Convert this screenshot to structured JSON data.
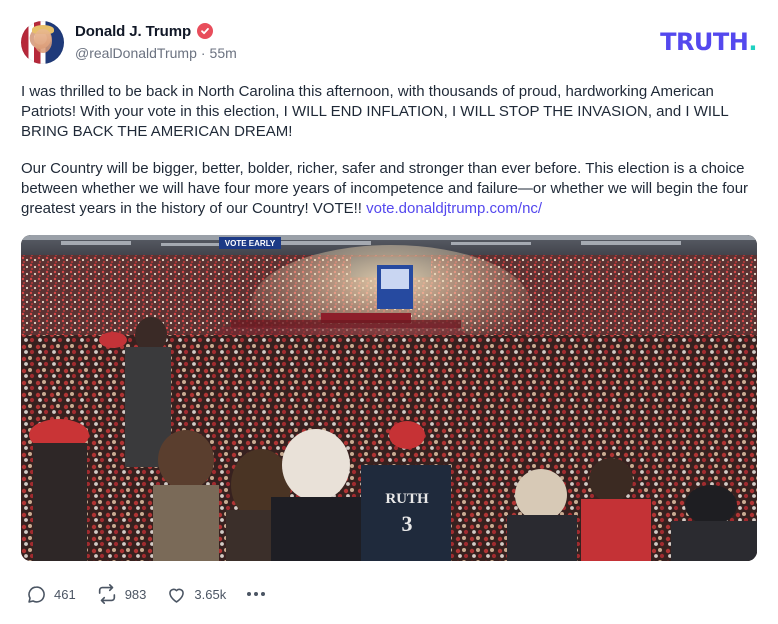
{
  "author": {
    "display_name": "Donald J. Trump",
    "handle": "@realDonaldTrump",
    "separator": "·",
    "timestamp": "55m",
    "avatar_icon": "profile-photo",
    "verified_icon": "verified-badge-icon"
  },
  "brand": {
    "logo_text": "TRUTH",
    "logo_dot": ".",
    "colors": {
      "primary": "#5448ee",
      "accent": "#1fd1c1"
    }
  },
  "post": {
    "paragraph_1": "I was thrilled to be back in North Carolina this afternoon, with thousands of proud, hardworking American Patriots! With your vote in this election, I WILL END INFLATION, I WILL STOP THE INVASION, and I WILL BRING BACK THE AMERICAN DREAM!",
    "paragraph_2_text": "Our Country will be bigger, better, bolder, richer, safer and stronger than ever before. This election is a choice between whether we will have four more years of incompetence and failure—or whether we will begin the four greatest years in the history of our Country! VOTE!! ",
    "paragraph_2_link": "vote.donaldjtrump.com/nc/",
    "media_banner_text": "VOTE EARLY",
    "media_shirt_text": "RUTH",
    "media_shirt_number": "3"
  },
  "actions": {
    "replies": "461",
    "retruths": "983",
    "likes": "3.65k",
    "more_icon": "ellipsis-icon"
  }
}
